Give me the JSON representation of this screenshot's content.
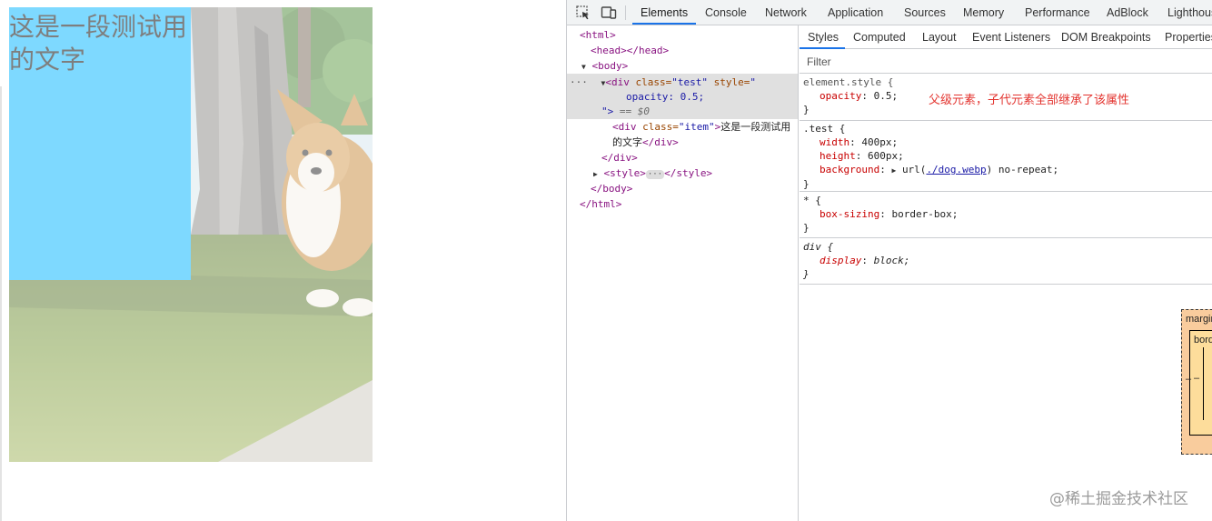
{
  "preview": {
    "item_text": "这是一段测试用的文字"
  },
  "devtools": {
    "tabs": [
      "Elements",
      "Console",
      "Network",
      "Application",
      "Sources",
      "Memory",
      "Performance",
      "AdBlock",
      "Lighthouse"
    ],
    "active_tab": "Elements",
    "dom": {
      "html_open": "<html>",
      "head": "<head></head>",
      "body_open": "<body>",
      "div_tag_open": "<div",
      "div_class_attr": "class=",
      "div_class_val": "\"test\"",
      "div_style_attr": "style=",
      "div_style_val": "\"",
      "div_style_inner": "opacity: 0.5;",
      "div_style_close": "\">",
      "selected_marker": "== $0",
      "item_open_tag": "<div",
      "item_class_attr": "class=",
      "item_class_val": "\"item\"",
      "item_gt": ">",
      "item_text_line1": "这是一段测试用",
      "item_text_line2": "的文字",
      "item_close": "</div>",
      "div_close": "</div>",
      "style_open": "<style>",
      "style_close": "</style>",
      "body_close": "</body>",
      "html_close": "</html>",
      "ellipsis": "···",
      "row_dots": "···"
    },
    "styles": {
      "subtabs": [
        "Styles",
        "Computed",
        "Layout",
        "Event Listeners",
        "DOM Breakpoints",
        "Properties"
      ],
      "active_subtab": "Styles",
      "filter_placeholder": "Filter",
      "annotation": "父级元素，子代元素全部继承了该属性",
      "rules": {
        "element_style": {
          "selector": "element.style {",
          "prop": "opacity",
          "value": "0.5;"
        },
        "test": {
          "selector": ".test {",
          "width_prop": "width",
          "width_val": "400px;",
          "height_prop": "height",
          "height_val": "600px;",
          "bg_prop": "background",
          "bg_val_pre": "url(",
          "bg_link": "./dog.webp",
          "bg_val_post": ") no-repeat;"
        },
        "universal": {
          "selector": "* {",
          "prop": "box-sizing",
          "value": "border-box;"
        },
        "div": {
          "selector": "div {",
          "prop": "display",
          "value": "block;"
        },
        "close": "}"
      },
      "box_model": {
        "margin_label": "margin",
        "border_label": "border",
        "dash": "–"
      }
    }
  },
  "watermark": "@稀土掘金技术社区",
  "colors": {
    "item_bg": "#00b4ff",
    "accent": "#1a73e8",
    "annotation": "#e3342f"
  }
}
